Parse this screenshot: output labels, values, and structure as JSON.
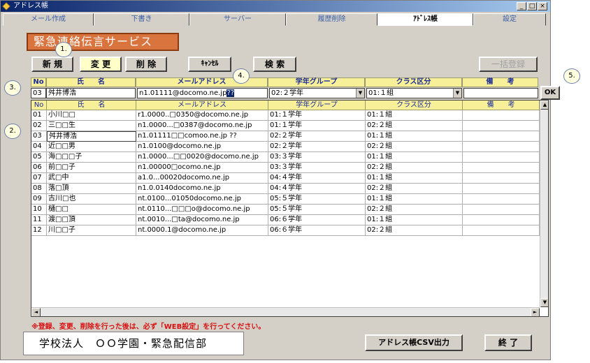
{
  "window": {
    "title": "アドレス帳"
  },
  "tabs": [
    "メール作成",
    "下書き",
    "サーバー",
    "履歴削除",
    "ｱﾄﾞﾚｽ帳",
    "設定"
  ],
  "banner": "緊急連絡伝言サービス",
  "toolbar": {
    "new_label": "新 規",
    "change_label": "変 更",
    "delete_label": "削 除",
    "cancel_label": "ｷｬﾝｾﾙ",
    "search_label": "検 索",
    "bulk_label": "一括登録"
  },
  "callouts": [
    "1.",
    "2.",
    "3.",
    "4.",
    "5."
  ],
  "edit": {
    "headers": [
      "No",
      "氏　　名",
      "メールアドレス",
      "学年グループ",
      "クラス区分",
      "備　　考"
    ],
    "no": "03",
    "name": "舛井博浩",
    "email": "n1.01111@docomo.ne.jp",
    "email_sel": "??",
    "grade": "02:２学年",
    "class": "01:１組",
    "note": "",
    "ok_label": "OK"
  },
  "grid": {
    "columns": [
      "No",
      "氏　　名",
      "メールアドレス",
      "学年グループ",
      "クラス区分",
      "備　　考"
    ],
    "rows": [
      [
        "01",
        "小川□□",
        "r1.0000..□0350@docomo.ne.jp",
        "01:１学年",
        "01:１組",
        ""
      ],
      [
        "02",
        "三□□生",
        "n1.0000...□0387@docomo.ne.jp",
        "01:１学年",
        "02:２組",
        ""
      ],
      [
        "03",
        "舛井博浩",
        "n1.01111□□comoo.ne.jp ??",
        "02:２学年",
        "01:１組",
        ""
      ],
      [
        "04",
        "近□□男",
        "n1.0100@docomo.ne.jp",
        "02:２学年",
        "02:２組",
        ""
      ],
      [
        "05",
        "海□□□子",
        "n1.0000...□□0020@docomo.ne.jp",
        "03:３学年",
        "01:１組",
        ""
      ],
      [
        "06",
        "前□□子",
        "n1.00000□ocomo.ne.jp",
        "03:３学年",
        "02:２組",
        ""
      ],
      [
        "07",
        "武□中",
        "a1.0...00020docomo.ne.jp",
        "04:４学年",
        "01:１組",
        ""
      ],
      [
        "08",
        "落□頂",
        "n1.0.0140docomo.ne.jp",
        "04:４学年",
        "02:２組",
        ""
      ],
      [
        "09",
        "古川□也",
        "nt.0100...01050docomo.ne.jp",
        "05:５学年",
        "01:１組",
        ""
      ],
      [
        "10",
        "樋□□",
        "nt.0110...□□□o@docomo.ne.jp",
        "05:５学年",
        "02:２組",
        ""
      ],
      [
        "11",
        "渡□□頂",
        "nt.0010...□ta@docomo.ne.jp",
        "06:６学年",
        "01:１組",
        ""
      ],
      [
        "12",
        "川□□子",
        "nt.0000.1@docomo.ne.jp",
        "06:６学年",
        "02:２組",
        ""
      ]
    ]
  },
  "warning": "※登録、変更、削除を行った後は、必ず「WEB設定」を行ってください。",
  "org": "学校法人　ＯＯ学園・緊急配信部",
  "footer": {
    "csv_label": "アドレス帳CSV出力",
    "exit_label": "終 了"
  }
}
